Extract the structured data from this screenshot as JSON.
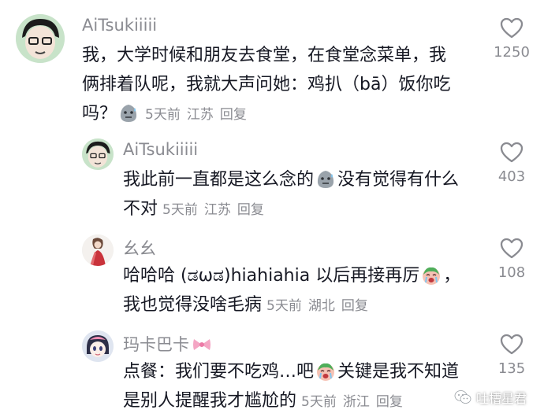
{
  "comments": [
    {
      "username": "AiTsukiiiii",
      "text_line1": "我，大学时候和朋友去食堂，在食堂念菜单，我",
      "text_line2": "俩排着队呢，我就大声问她：鸡扒（bā）饭你吃",
      "text_line3_pre": "吗？",
      "time": "5天前",
      "location": "江苏",
      "reply": "回复",
      "likes": "1250"
    },
    {
      "username": "AiTsukiiiii",
      "text_line1_pre": "我此前一直都是这么念的",
      "text_line1_post": "没有觉得有什么",
      "text_line2_pre": "不对",
      "time": "5天前",
      "location": "江苏",
      "reply": "回复",
      "likes": "403"
    },
    {
      "username": "幺幺",
      "text_line1_pre": "哈哈哈 (ಡωಡ)hiahiahia 以后再接再厉",
      "text_line1_post": "，",
      "text_line2_pre": "我也觉得没啥毛病",
      "time": "5天前",
      "location": "湖北",
      "reply": "回复",
      "likes": "108"
    },
    {
      "username": "玛卡巴卡",
      "text_line1_pre": "点餐：我们要不吃鸡…吧",
      "text_line1_post": "关键是我不知道",
      "text_line2_pre": "是别人提醒我才尴尬的",
      "time": "5天前",
      "location": "浙江",
      "reply": "回复",
      "likes": "135"
    }
  ],
  "watermark": {
    "text": "吐槽星君"
  },
  "colors": {
    "text": "#161823",
    "secondary": "#8a8b91",
    "background": "#ffffff"
  }
}
